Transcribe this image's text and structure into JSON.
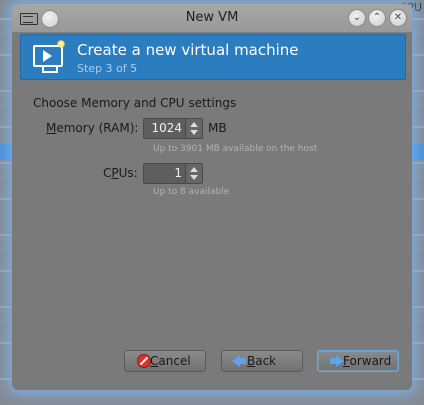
{
  "background": {
    "label": "CPU"
  },
  "window": {
    "title": "New VM"
  },
  "banner": {
    "title": "Create a new virtual machine",
    "step": "Step 3 of 5",
    "icon": "virtual-machine-monitor-icon"
  },
  "content": {
    "section_title": "Choose Memory and CPU settings",
    "memory": {
      "label_mnemonic": "M",
      "label_rest": "emory (RAM):",
      "value": "1024",
      "unit": "MB",
      "hint": "Up to 3901 MB available on the host"
    },
    "cpus": {
      "label_pre": "C",
      "label_mnemonic": "P",
      "label_post": "Us:",
      "value": "1",
      "hint": "Up to 8 available"
    }
  },
  "buttons": {
    "cancel_mnemonic": "C",
    "cancel_rest": "ancel",
    "back_mnemonic": "B",
    "back_rest": "ack",
    "forward_mnemonic": "F",
    "forward_rest": "orward"
  },
  "colors": {
    "banner": "#2c7dbf",
    "window_glow": "#78b9ff",
    "dialog_body": "#7a7a7a"
  }
}
